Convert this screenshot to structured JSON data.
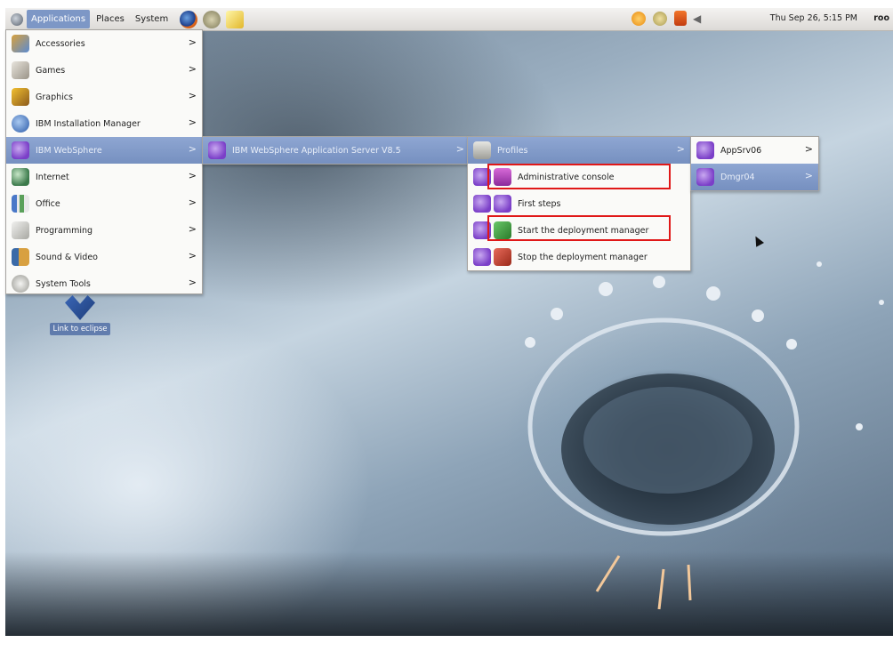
{
  "panel": {
    "menus": [
      "Applications",
      "Places",
      "System"
    ],
    "clock": "Thu Sep 26,  5:15 PM",
    "user": "roo"
  },
  "apps_menu": {
    "items": [
      {
        "label": "Accessories",
        "icon": "accessories-icon"
      },
      {
        "label": "Games",
        "icon": "games-icon"
      },
      {
        "label": "Graphics",
        "icon": "graphics-icon"
      },
      {
        "label": "IBM Installation Manager",
        "icon": "ibm-installation-manager-icon"
      },
      {
        "label": "IBM WebSphere",
        "icon": "websphere-icon"
      },
      {
        "label": "Internet",
        "icon": "internet-globe-icon"
      },
      {
        "label": "Office",
        "icon": "office-icon"
      },
      {
        "label": "Programming",
        "icon": "programming-icon"
      },
      {
        "label": "Sound & Video",
        "icon": "sound-video-icon"
      },
      {
        "label": "System Tools",
        "icon": "system-tools-icon"
      }
    ]
  },
  "websphere_menu": {
    "item": "IBM WebSphere Application Server V8.5"
  },
  "was_menu": {
    "profiles_label": "Profiles",
    "items": [
      {
        "label": "Administrative console"
      },
      {
        "label": "First steps"
      },
      {
        "label": "Start the deployment manager"
      },
      {
        "label": "Stop the deployment manager"
      }
    ]
  },
  "profiles_menu": {
    "items": [
      {
        "label": "AppSrv06"
      },
      {
        "label": "Dmgr04"
      }
    ]
  },
  "desktop": {
    "eclipse_label": "Link to eclipse"
  },
  "colors": {
    "menu_highlight": "#7d97c6",
    "annotation_red": "#e01818"
  }
}
